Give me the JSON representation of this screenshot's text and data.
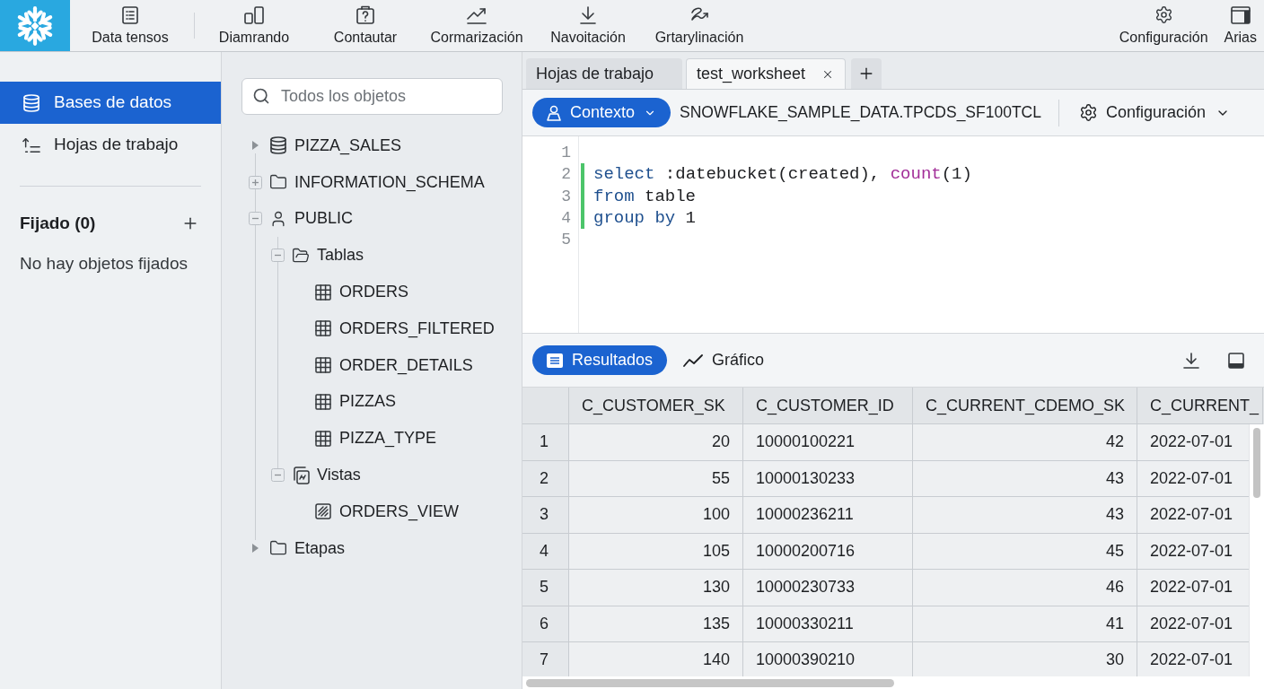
{
  "top_nav": {
    "items": [
      {
        "label": "Data tensos",
        "kind": "list"
      },
      {
        "label": "Diamrando",
        "kind": "bars"
      },
      {
        "label": "Contautar",
        "kind": "clipboard"
      },
      {
        "label": "Cormarización",
        "kind": "trend"
      },
      {
        "label": "Navoitación",
        "kind": "download"
      },
      {
        "label": "Grtarylinación",
        "kind": "squiggle"
      }
    ],
    "right_items": [
      {
        "label": "Configuración",
        "kind": "gear"
      },
      {
        "label": "Arias",
        "kind": "window"
      }
    ]
  },
  "sidebar": {
    "items": [
      {
        "label": "Bases de datos",
        "kind": "database",
        "selected": true
      },
      {
        "label": "Hojas de trabajo",
        "kind": "worksheets",
        "selected": false
      }
    ],
    "pinned": {
      "title": "Fijado (0)",
      "empty_text": "No hay objetos fijados"
    }
  },
  "object_browser": {
    "search": {
      "placeholder": "Todos los objetos"
    },
    "tree": [
      {
        "label": "PIZZA_SALES",
        "kind": "database",
        "toggle": {
          "kind": "caret",
          "expanded": false
        }
      },
      {
        "label": "INFORMATION_SCHEMA",
        "kind": "folder",
        "toggle": {
          "kind": "box",
          "expanded": false
        }
      },
      {
        "label": "PUBLIC",
        "kind": "schema",
        "toggle": {
          "kind": "box",
          "expanded": true
        },
        "children": [
          {
            "label": "Tablas",
            "kind": "folder-open",
            "toggle": {
              "kind": "box",
              "expanded": true
            },
            "children": [
              {
                "label": "ORDERS",
                "kind": "table"
              },
              {
                "label": "ORDERS_FILTERED",
                "kind": "table"
              },
              {
                "label": "ORDER_DETAILS",
                "kind": "table"
              },
              {
                "label": "PIZZAS",
                "kind": "table"
              },
              {
                "label": "PIZZA_TYPE",
                "kind": "table"
              }
            ]
          },
          {
            "label": "Vistas",
            "kind": "views",
            "toggle": {
              "kind": "box",
              "expanded": true
            },
            "children": [
              {
                "label": "ORDERS_VIEW",
                "kind": "view"
              }
            ]
          }
        ]
      },
      {
        "label": "Etapas",
        "kind": "folder",
        "toggle": {
          "kind": "caret",
          "expanded": false
        }
      }
    ]
  },
  "worksheet_tabs": [
    {
      "label": "Hojas de trabajo",
      "selected": false
    },
    {
      "label": "test_worksheet",
      "selected": true
    }
  ],
  "context_bar": {
    "context_button": "Contexto",
    "path": "SNOWFLAKE_SAMPLE_DATA.TPCDS_SF100TCL",
    "settings": "Configuración"
  },
  "editor": {
    "lines": [
      {
        "number": "1",
        "modified": false
      },
      {
        "number": "2",
        "modified": true,
        "tokens": [
          {
            "text": "select",
            "kind": "keyword"
          },
          {
            "text": " :datebucket(created), ",
            "kind": "plain"
          },
          {
            "text": "count",
            "kind": "function"
          },
          {
            "text": "(1)",
            "kind": "plain"
          }
        ]
      },
      {
        "number": "3",
        "modified": true,
        "tokens": [
          {
            "text": "from",
            "kind": "keyword"
          },
          {
            "text": " table",
            "kind": "plain"
          }
        ]
      },
      {
        "number": "4",
        "modified": true,
        "tokens": [
          {
            "text": "group by",
            "kind": "keyword"
          },
          {
            "text": " 1",
            "kind": "plain"
          }
        ]
      },
      {
        "number": "5",
        "modified": false
      }
    ]
  },
  "results": {
    "tabs": [
      {
        "label": "Resultados",
        "kind": "table",
        "selected": true
      },
      {
        "label": "Gráfico",
        "kind": "chart",
        "selected": false
      }
    ],
    "table": {
      "columns": [
        {
          "label": "C_CUSTOMER_SK",
          "kind": "number"
        },
        {
          "label": "C_CUSTOMER_ID",
          "kind": "text"
        },
        {
          "label": "C_CURRENT_CDEMO_SK",
          "kind": "number"
        },
        {
          "label": "C_CURRENT_",
          "kind": "text"
        }
      ],
      "rows": [
        {
          "number": "1",
          "cells": [
            "20",
            "10000100221",
            "42",
            "2022-07-01"
          ]
        },
        {
          "number": "2",
          "cells": [
            "55",
            "10000130233",
            "43",
            "2022-07-01"
          ]
        },
        {
          "number": "3",
          "cells": [
            "100",
            "10000236211",
            "43",
            "2022-07-01"
          ]
        },
        {
          "number": "4",
          "cells": [
            "105",
            "10000200716",
            "45",
            "2022-07-01"
          ]
        },
        {
          "number": "5",
          "cells": [
            "130",
            "10000230733",
            "46",
            "2022-07-01"
          ]
        },
        {
          "number": "6",
          "cells": [
            "135",
            "10000330211",
            "41",
            "2022-07-01"
          ]
        },
        {
          "number": "7",
          "cells": [
            "140",
            "10000390210",
            "30",
            "2022-07-01"
          ]
        }
      ]
    }
  }
}
